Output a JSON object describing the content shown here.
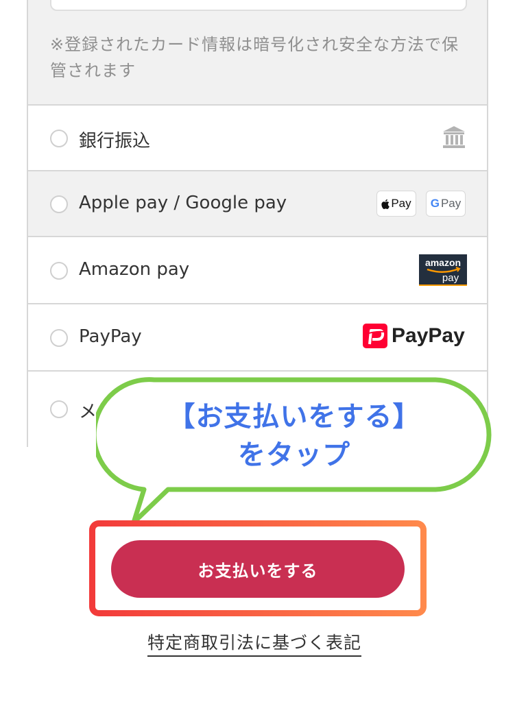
{
  "card_section": {
    "note": "※登録されたカード情報は暗号化され安全な方法で保管されます"
  },
  "payment_options": [
    {
      "label": "銀行振込",
      "icon": "bank-icon"
    },
    {
      "label": "Apple pay / Google pay",
      "icon": "apple-pay-google-pay-badges",
      "apple_badge": "Pay",
      "google_badge_g": "G",
      "google_badge_text": "Pay"
    },
    {
      "label": "Amazon pay",
      "icon": "amazon-pay-logo",
      "logo_top": "amazon",
      "logo_bottom": "pay"
    },
    {
      "label": "PayPay",
      "icon": "paypay-logo",
      "logo_text": "PayPay"
    },
    {
      "label": "メルペイ",
      "icon": "merpay-logo"
    }
  ],
  "callout": {
    "line1": "【お支払いをする】",
    "line2": "をタップ",
    "color": "#4073e8",
    "border_color": "#7dcc4a"
  },
  "submit_button": {
    "label": "お支払いをする",
    "color": "#c92f52"
  },
  "footer": {
    "legal_link": "特定商取引法に基づく表記"
  }
}
